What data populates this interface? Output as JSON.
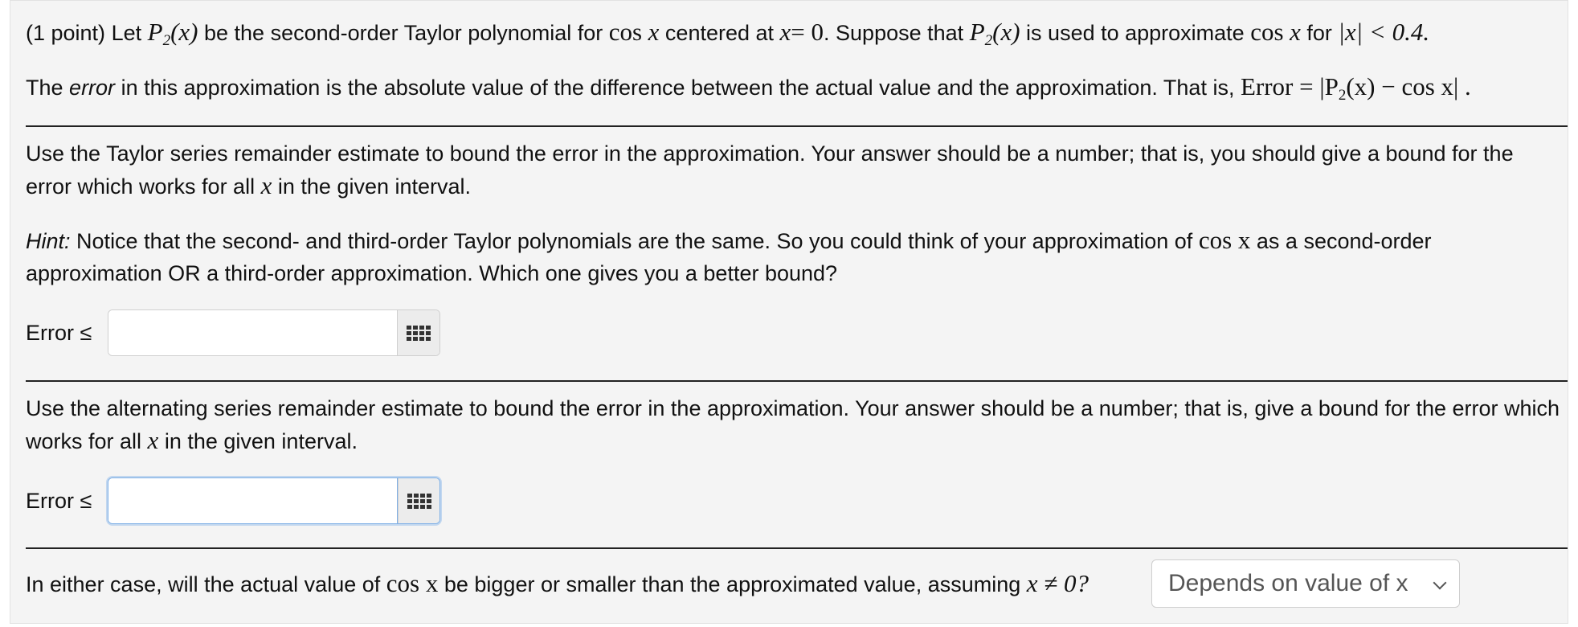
{
  "problem": {
    "intro": {
      "points": "(1 point)",
      "let": "Let",
      "p": "P",
      "sub2": "2",
      "px": "(x)",
      "text1": "be the second-order Taylor polynomial for",
      "cos": "cos",
      "x": "x",
      "text2": "centered at",
      "eq0": "= 0",
      "text3": ". Suppose that",
      "text4": "is used to approximate",
      "text5": "for",
      "abs": "|x| < 0.4."
    },
    "error_def": {
      "text1": "The",
      "error_word": "error",
      "text2": "in this approximation is the absolute value of the difference between the actual value and the approximation. That is,",
      "formula_left": "Error = |P",
      "formula_sub": "2",
      "formula_right": "(x) − cos x| ."
    },
    "part1": {
      "text1": "Use the Taylor series remainder estimate to bound the error in the approximation. Your answer should be a number; that is, you should give a bound for the error which works for all",
      "x": "x",
      "text2": "in the given interval.",
      "hint_label": "Hint:",
      "hint_text1": "Notice that the second- and third-order Taylor polynomials are the same. So you could think of your approximation of",
      "hint_cos": "cos x",
      "hint_text2": "as a second-order approximation OR a third-order approximation. Which one gives you a better bound?",
      "error_label": "Error ≤",
      "input_value": ""
    },
    "part2": {
      "text1": "Use the alternating series remainder estimate to bound the error in the approximation. Your answer should be a number; that is, give a bound for the error which works for all",
      "x": "x",
      "text2": "in the given interval.",
      "error_label": "Error ≤",
      "input_value": ""
    },
    "part3": {
      "text1": "In either case, will the actual value of",
      "cos": "cos x",
      "text2": "be bigger or smaller than the approximated value, assuming",
      "cond": "x ≠ 0?",
      "select_value": "Depends on value of x"
    }
  }
}
